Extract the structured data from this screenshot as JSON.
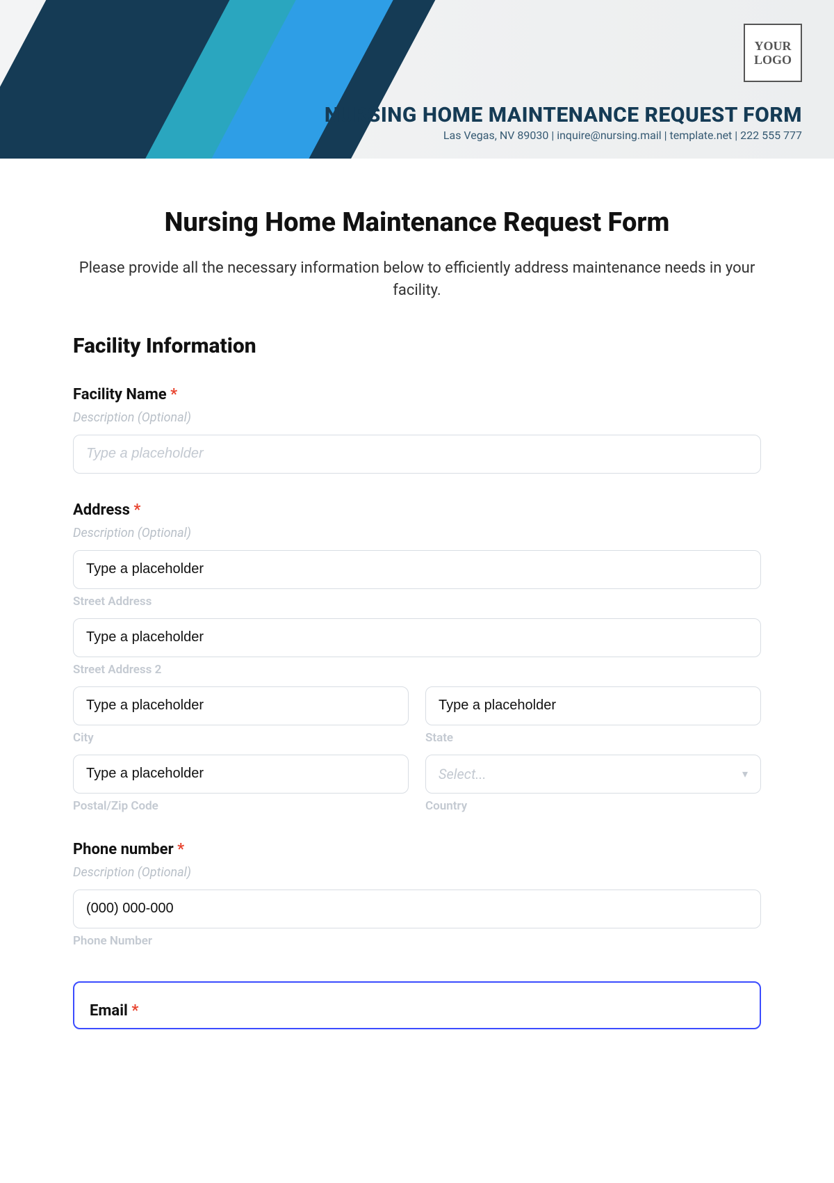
{
  "banner": {
    "logo_text": "YOUR LOGO",
    "title": "NURSING HOME MAINTENANCE REQUEST FORM",
    "subtitle": "Las Vegas, NV 89030 | inquire@nursing.mail | template.net | 222 555 777"
  },
  "form": {
    "title": "Nursing Home Maintenance Request Form",
    "intro": "Please provide all the necessary information below to efficiently address maintenance needs in your facility.",
    "required_mark": "*",
    "section1_title": "Facility Information",
    "facility_name": {
      "label": "Facility Name",
      "desc": "Description (Optional)",
      "placeholder": "Type a placeholder"
    },
    "address": {
      "label": "Address",
      "desc": "Description (Optional)",
      "street1_value": "Type a placeholder",
      "street1_sub": "Street Address",
      "street2_value": "Type a placeholder",
      "street2_sub": "Street Address 2",
      "city_value": "Type a placeholder",
      "city_sub": "City",
      "state_value": "Type a placeholder",
      "state_sub": "State",
      "zip_value": "Type a placeholder",
      "zip_sub": "Postal/Zip Code",
      "country_value": "Select...",
      "country_sub": "Country"
    },
    "phone": {
      "label": "Phone number",
      "desc": "Description (Optional)",
      "value": "(000) 000-000",
      "sub": "Phone Number"
    },
    "email": {
      "label": "Email"
    }
  }
}
